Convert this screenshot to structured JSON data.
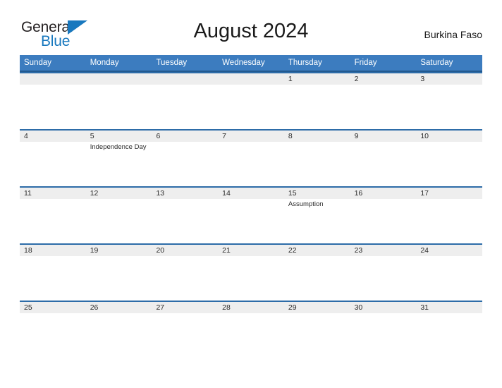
{
  "brand": {
    "name_part1": "General",
    "name_part2": "Blue",
    "accent_color": "#1878be"
  },
  "header": {
    "title": "August 2024",
    "country": "Burkina Faso"
  },
  "calendar": {
    "header_color": "#3c7cbf",
    "header_border_color": "#22598f",
    "row_band_color": "#eeeeee",
    "weekdays": [
      "Sunday",
      "Monday",
      "Tuesday",
      "Wednesday",
      "Thursday",
      "Friday",
      "Saturday"
    ],
    "weeks": [
      [
        {
          "date": "",
          "event": ""
        },
        {
          "date": "",
          "event": ""
        },
        {
          "date": "",
          "event": ""
        },
        {
          "date": "",
          "event": ""
        },
        {
          "date": "1",
          "event": ""
        },
        {
          "date": "2",
          "event": ""
        },
        {
          "date": "3",
          "event": ""
        }
      ],
      [
        {
          "date": "4",
          "event": ""
        },
        {
          "date": "5",
          "event": "Independence Day"
        },
        {
          "date": "6",
          "event": ""
        },
        {
          "date": "7",
          "event": ""
        },
        {
          "date": "8",
          "event": ""
        },
        {
          "date": "9",
          "event": ""
        },
        {
          "date": "10",
          "event": ""
        }
      ],
      [
        {
          "date": "11",
          "event": ""
        },
        {
          "date": "12",
          "event": ""
        },
        {
          "date": "13",
          "event": ""
        },
        {
          "date": "14",
          "event": ""
        },
        {
          "date": "15",
          "event": "Assumption"
        },
        {
          "date": "16",
          "event": ""
        },
        {
          "date": "17",
          "event": ""
        }
      ],
      [
        {
          "date": "18",
          "event": ""
        },
        {
          "date": "19",
          "event": ""
        },
        {
          "date": "20",
          "event": ""
        },
        {
          "date": "21",
          "event": ""
        },
        {
          "date": "22",
          "event": ""
        },
        {
          "date": "23",
          "event": ""
        },
        {
          "date": "24",
          "event": ""
        }
      ],
      [
        {
          "date": "25",
          "event": ""
        },
        {
          "date": "26",
          "event": ""
        },
        {
          "date": "27",
          "event": ""
        },
        {
          "date": "28",
          "event": ""
        },
        {
          "date": "29",
          "event": ""
        },
        {
          "date": "30",
          "event": ""
        },
        {
          "date": "31",
          "event": ""
        }
      ]
    ]
  }
}
